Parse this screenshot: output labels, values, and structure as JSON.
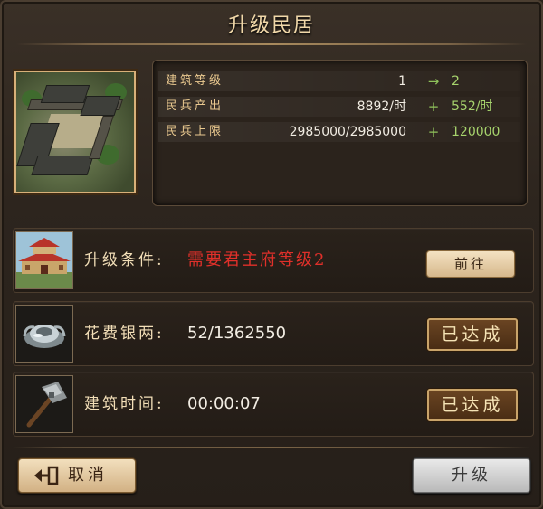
{
  "title": "升级民居",
  "building": {
    "image": "residence-building"
  },
  "stats": [
    {
      "label": "建筑等级",
      "current": "1",
      "op": "→",
      "next": "2"
    },
    {
      "label": "民兵产出",
      "current": "8892/时",
      "op": "+",
      "next": "552/时"
    },
    {
      "label": "民兵上限",
      "current": "2985000/2985000",
      "op": "+",
      "next": "120000"
    }
  ],
  "requirements": [
    {
      "icon": "palace-icon",
      "label": "升级条件:",
      "value": "需要君主府等级2",
      "action": "前往"
    },
    {
      "icon": "silver-ingot-icon",
      "label": "花费银两:",
      "value": "52/1362550",
      "status": "已达成"
    },
    {
      "icon": "hammer-icon",
      "label": "建筑时间:",
      "value": "00:00:07",
      "status": "已达成"
    }
  ],
  "buttons": {
    "cancel": "取消",
    "upgrade": "升级"
  },
  "colors": {
    "label": "#e9c88f",
    "green": "#a7d46d",
    "red": "#e0302a",
    "gold": "#f1d8a9"
  }
}
